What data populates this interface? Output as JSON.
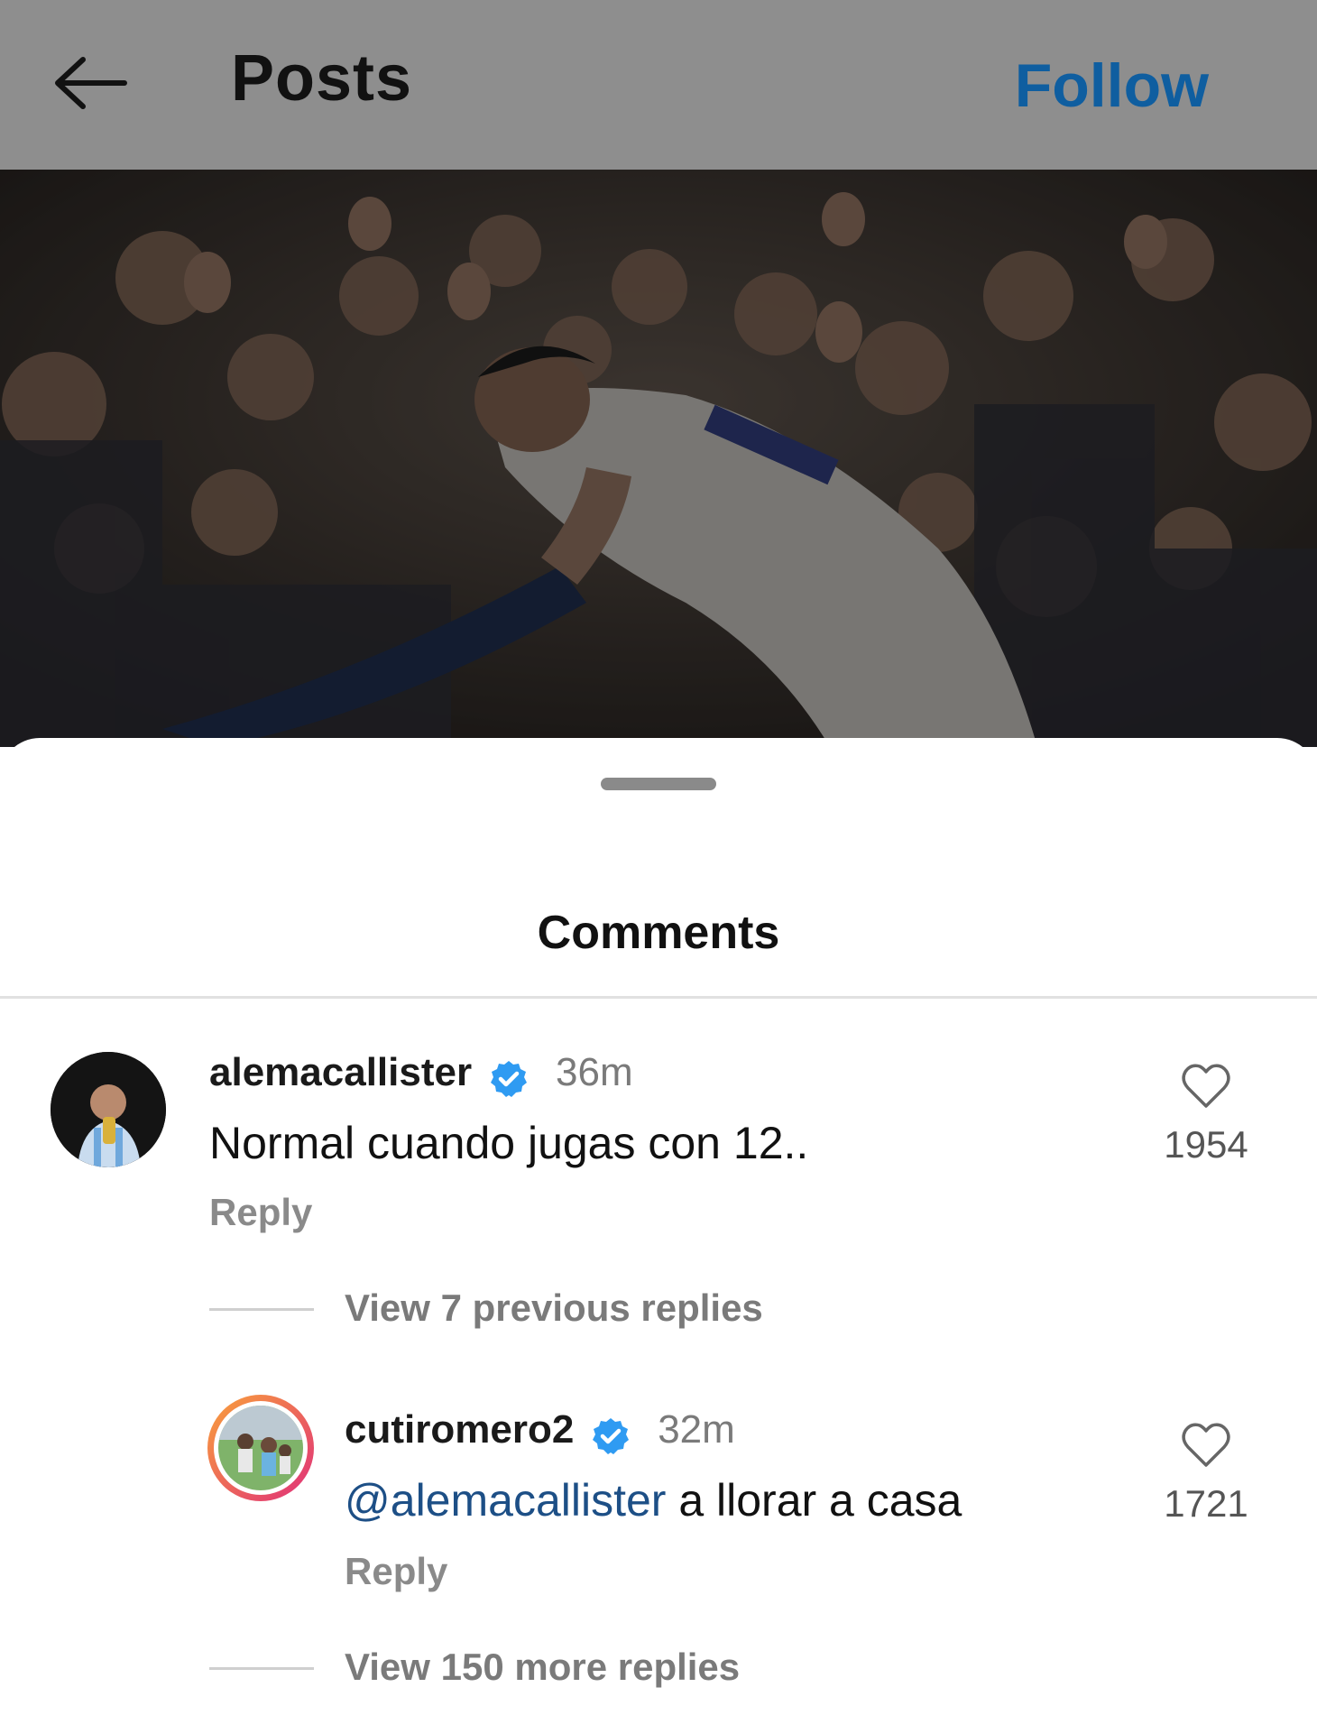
{
  "header": {
    "back_icon": "arrow-left-icon",
    "title": "Posts",
    "follow_label": "Follow",
    "follow_color": "#0f5ea0"
  },
  "sheet": {
    "title": "Comments"
  },
  "comments": [
    {
      "username": "alemacallister",
      "verified": true,
      "time": "36m",
      "text": "Normal cuando jugas con 12..",
      "reply_label": "Reply",
      "likes": "1954",
      "view_replies": "View 7 previous replies"
    },
    {
      "username": "cutiromero2",
      "verified": true,
      "time": "32m",
      "mention": "@alemacallister",
      "text": " a llorar a casa",
      "reply_label": "Reply",
      "likes": "1721",
      "view_replies": "View 150 more replies"
    }
  ],
  "colors": {
    "verified_badge": "#2f9bf2",
    "mention": "#1d4f86",
    "story_ring": [
      "#f9a23a",
      "#e02f7a"
    ]
  }
}
